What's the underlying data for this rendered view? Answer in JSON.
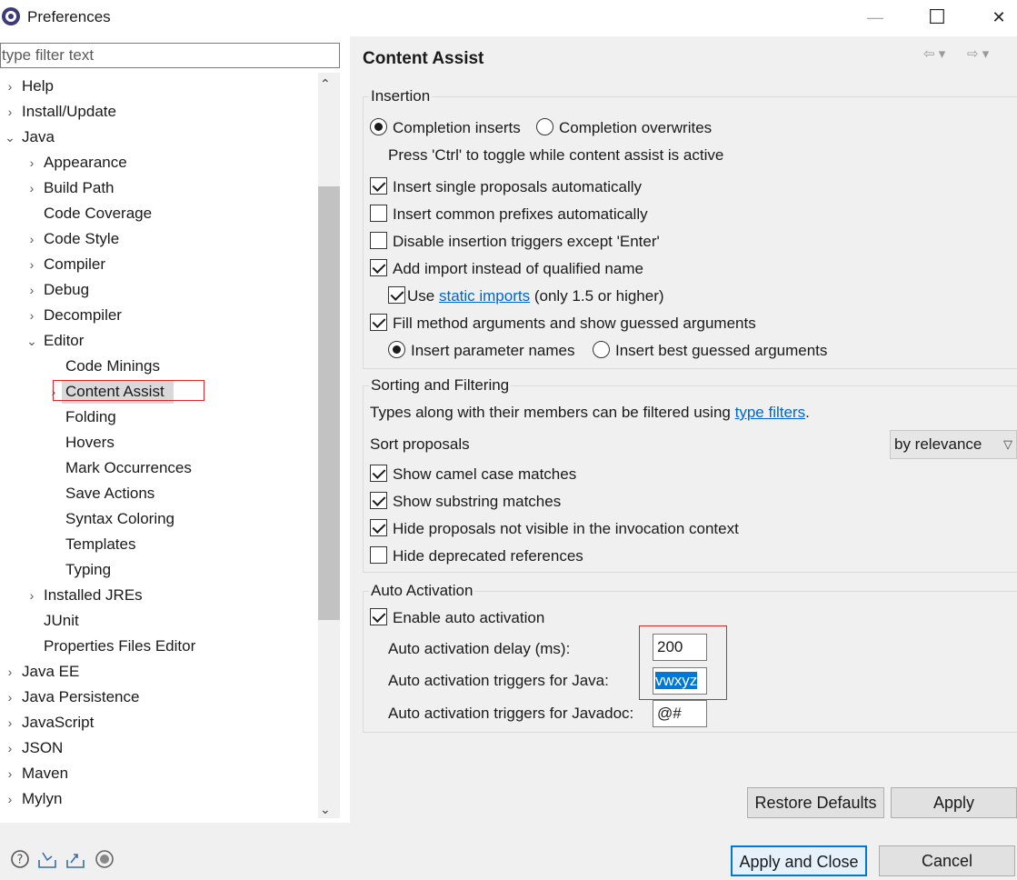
{
  "window": {
    "title": "Preferences",
    "minimize_glyph": "—",
    "maximize_glyph": "☐",
    "close_glyph": "✕"
  },
  "tree": {
    "filter_placeholder": "type filter text",
    "items": [
      {
        "label": "Help",
        "expander": "›"
      },
      {
        "label": "Install/Update",
        "expander": "›"
      },
      {
        "label": "Java",
        "expander": "⌄"
      },
      {
        "label": "Appearance",
        "expander": "›"
      },
      {
        "label": "Build Path",
        "expander": "›"
      },
      {
        "label": "Code Coverage",
        "expander": ""
      },
      {
        "label": "Code Style",
        "expander": "›"
      },
      {
        "label": "Compiler",
        "expander": "›"
      },
      {
        "label": "Debug",
        "expander": "›"
      },
      {
        "label": "Decompiler",
        "expander": "›"
      },
      {
        "label": "Editor",
        "expander": "⌄"
      },
      {
        "label": "Code Minings",
        "expander": ""
      },
      {
        "label": "Content Assist",
        "expander": "›"
      },
      {
        "label": "Folding",
        "expander": ""
      },
      {
        "label": "Hovers",
        "expander": ""
      },
      {
        "label": "Mark Occurrences",
        "expander": ""
      },
      {
        "label": "Save Actions",
        "expander": ""
      },
      {
        "label": "Syntax Coloring",
        "expander": ""
      },
      {
        "label": "Templates",
        "expander": ""
      },
      {
        "label": "Typing",
        "expander": ""
      },
      {
        "label": "Installed JREs",
        "expander": "›"
      },
      {
        "label": "JUnit",
        "expander": ""
      },
      {
        "label": "Properties Files Editor",
        "expander": ""
      },
      {
        "label": "Java EE",
        "expander": "›"
      },
      {
        "label": "Java Persistence",
        "expander": "›"
      },
      {
        "label": "JavaScript",
        "expander": "›"
      },
      {
        "label": "JSON",
        "expander": "›"
      },
      {
        "label": "Maven",
        "expander": "›"
      },
      {
        "label": "Mylyn",
        "expander": "›"
      }
    ],
    "scroll_up": "⌃",
    "scroll_down": "⌄"
  },
  "page": {
    "title": "Content Assist",
    "nav_back": "⇦ ▾",
    "nav_forward": "⇨ ▾"
  },
  "insertion": {
    "label": "Insertion",
    "completion_inserts": "Completion inserts",
    "completion_overwrites": "Completion overwrites",
    "ctrl_hint": "Press 'Ctrl' to toggle while content assist is active",
    "insert_single": "Insert single proposals automatically",
    "insert_common": "Insert common prefixes automatically",
    "disable_triggers": "Disable insertion triggers except 'Enter'",
    "add_import": "Add import instead of qualified name",
    "use": "Use",
    "static_imports": "static imports",
    "only_15": "(only 1.5 or higher)",
    "fill_method": "Fill method arguments and show guessed arguments",
    "insert_param_names": "Insert parameter names",
    "insert_best_guessed": "Insert best guessed arguments"
  },
  "sorting": {
    "label": "Sorting and Filtering",
    "types_text": "Types along with their members can be filtered using",
    "type_filters": "type filters",
    "period": ".",
    "sort_proposals": "Sort proposals",
    "sort_value": "by relevance",
    "camel_case": "Show camel case matches",
    "substring": "Show substring matches",
    "hide_not_visible": "Hide proposals not visible in the invocation context",
    "hide_deprecated": "Hide deprecated references"
  },
  "auto": {
    "label": "Auto Activation",
    "enable": "Enable auto activation",
    "delay_label": "Auto activation delay (ms):",
    "delay_value": "200",
    "java_label": "Auto activation triggers for Java:",
    "java_value": "vwxyz",
    "javadoc_label": "Auto activation triggers for Javadoc:",
    "javadoc_value": "@#"
  },
  "buttons": {
    "restore_defaults": "Restore Defaults",
    "apply": "Apply",
    "apply_and_close": "Apply and Close",
    "cancel": "Cancel"
  },
  "colors": {
    "accent": "#0078d7",
    "highlight_red": "#e0262b",
    "link": "#0066cc"
  },
  "bottom_icons": [
    "help-icon",
    "import-icon",
    "export-icon",
    "record-icon"
  ]
}
